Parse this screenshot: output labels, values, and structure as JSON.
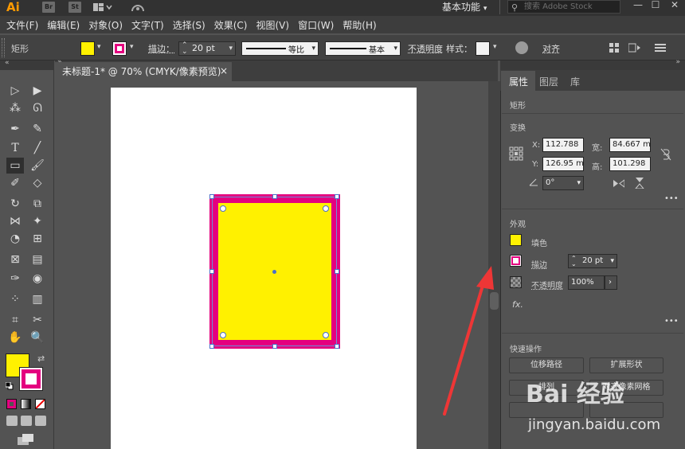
{
  "app": {
    "logo": "Ai",
    "bridge_icon": "Br",
    "stock_icon": "St",
    "workspace": "基本功能",
    "search_placeholder": "搜索 Adobe Stock",
    "win_min": "—",
    "win_max": "☐",
    "win_close": "✕"
  },
  "menu": [
    "文件(F)",
    "编辑(E)",
    "对象(O)",
    "文字(T)",
    "选择(S)",
    "效果(C)",
    "视图(V)",
    "窗口(W)",
    "帮助(H)"
  ],
  "controlbar": {
    "object_type": "矩形",
    "stroke_label": "描边：",
    "stroke_weight": "20 pt",
    "profile_uniform": "等比",
    "brush_basic": "基本",
    "opacity_label": "不透明度",
    "style_label": "样式：",
    "align_label": "对齐"
  },
  "document": {
    "tab_title": "未标题-1* @ 70% (CMYK/像素预览)",
    "close": "×"
  },
  "colors": {
    "fill": "#fff100",
    "stroke": "#e4007f",
    "arrow": "#ee3636"
  },
  "panel": {
    "tabs": [
      "属性",
      "图层",
      "库"
    ],
    "object": "矩形",
    "transform_title": "变换",
    "x_label": "X:",
    "x_value": "112.788",
    "y_label": "Y:",
    "y_value": "126.95 m",
    "w_label": "宽:",
    "w_value": "84.667 m",
    "h_label": "高:",
    "h_value": "101.298",
    "angle_value": "0°",
    "appearance_title": "外观",
    "fill_label": "填色",
    "stroke_label": "描边",
    "stroke_value": "20 pt",
    "opacity_label": "不透明度",
    "opacity_value": "100%",
    "fx": "fx.",
    "quick_title": "快速操作",
    "btn_offset_path": "位移路径",
    "btn_expand_shape": "扩展形状",
    "btn_arrange": "排列",
    "btn_align_pixel": "对齐像素网格",
    "more": "•••"
  },
  "watermark": {
    "logo": "Bai 经验",
    "url": "jingyan.baidu.com"
  }
}
